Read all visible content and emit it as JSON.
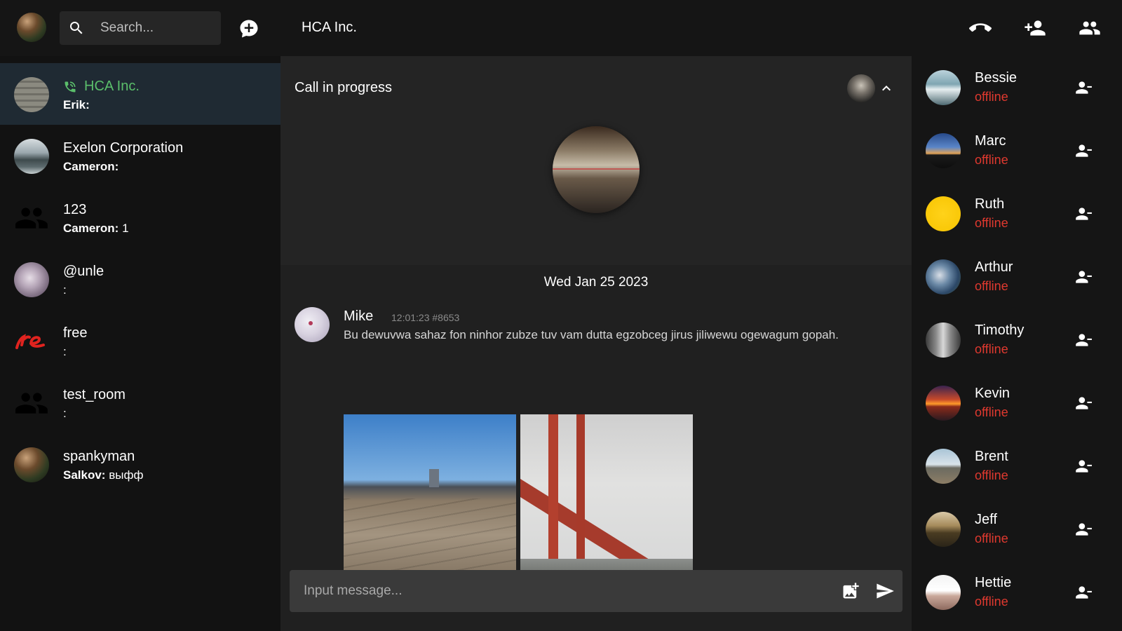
{
  "header": {
    "search_placeholder": "Search...",
    "room_title": "HCA Inc."
  },
  "sidebar": {
    "rooms": [
      {
        "name": "HCA Inc.",
        "sender": "Erik:",
        "text": "",
        "active": true,
        "in_call": true
      },
      {
        "name": "Exelon Corporation",
        "sender": "Cameron:",
        "text": ""
      },
      {
        "name": "123",
        "sender": "Cameron:",
        "text": " 1"
      },
      {
        "name": "@unle",
        "sender": "",
        "text": ":"
      },
      {
        "name": "free",
        "sender": "",
        "text": ":"
      },
      {
        "name": "test_room",
        "sender": "",
        "text": ":"
      },
      {
        "name": "spankyman",
        "sender": "Salkov:",
        "text": " выфф"
      }
    ]
  },
  "call": {
    "label": "Call in progress"
  },
  "timeline": {
    "date": "Wed Jan 25 2023",
    "message": {
      "author": "Mike",
      "meta": "12:01:23 #8653",
      "body": "Bu dewuvwa sahaz fon ninhor zubze tuv vam dutta egzobceg jirus jiliwewu ogewagum gopah."
    }
  },
  "composer": {
    "placeholder": "Input message..."
  },
  "members": [
    {
      "name": "Bessie",
      "status": "offline"
    },
    {
      "name": "Marc",
      "status": "offline"
    },
    {
      "name": "Ruth",
      "status": "offline"
    },
    {
      "name": "Arthur",
      "status": "offline"
    },
    {
      "name": "Timothy",
      "status": "offline"
    },
    {
      "name": "Kevin",
      "status": "offline"
    },
    {
      "name": "Brent",
      "status": "offline"
    },
    {
      "name": "Jeff",
      "status": "offline"
    },
    {
      "name": "Hettie",
      "status": "offline"
    }
  ],
  "colors": {
    "in_call_green": "#5bbf6b",
    "offline_red": "#e0392f",
    "active_room_bg": "#1f2a33"
  }
}
